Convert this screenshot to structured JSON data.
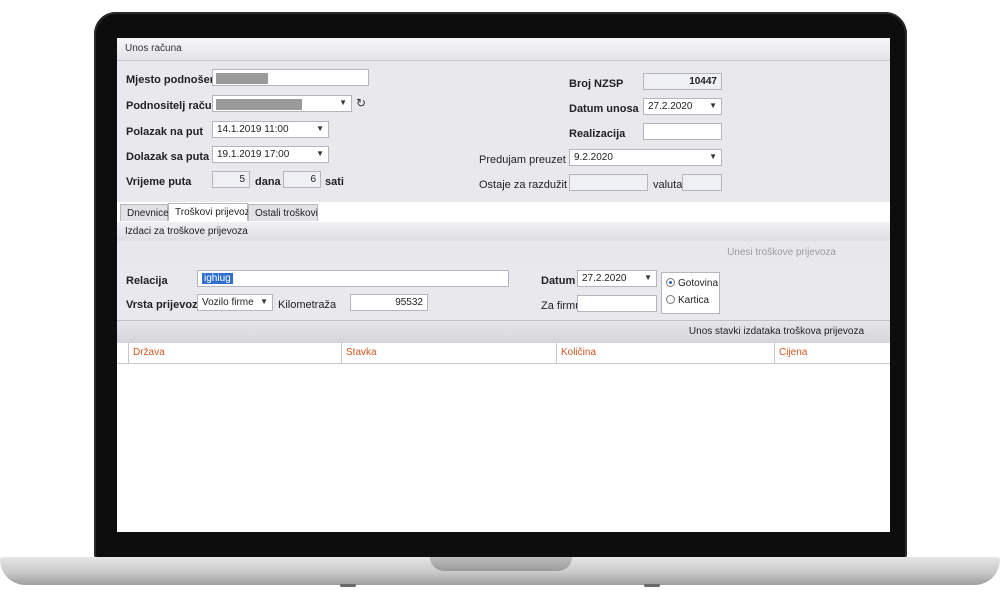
{
  "window": {
    "title": "Unos računa"
  },
  "header": {
    "mjesto_label": "Mjesto podnošenja",
    "podnositelj_label": "Podnositelj računa",
    "polazak_label": "Polazak na put",
    "polazak_value": "14.1.2019 11:00",
    "dolazak_label": "Dolazak sa puta",
    "dolazak_value": "19.1.2019 17:00",
    "vrijeme_label": "Vrijeme puta",
    "dana_value": "5",
    "dana_label": "dana",
    "sati_value": "6",
    "sati_label": "sati",
    "broj_label": "Broj NZSP",
    "broj_value": "10447",
    "datum_unosa_label": "Datum unosa",
    "datum_unosa_value": "27.2.2020",
    "realizacija_label": "Realizacija",
    "predujam_label": "Predujam preuzet",
    "predujam_value": "9.2.2020",
    "ostaje_label": "Ostaje za razdužit",
    "valuta_label": "valuta"
  },
  "tabs": [
    {
      "label": "Dnevnice"
    },
    {
      "label": "Troškovi prijevoza"
    },
    {
      "label": "Ostali troškovi"
    }
  ],
  "section": {
    "title": "Izdaci za troškove prijevoza",
    "action": "Unesi troškove prijevoza"
  },
  "detail": {
    "relacija_label": "Relacija",
    "relacija_value": "ighiug",
    "vrsta_label": "Vrsta prijevoza",
    "vrsta_value": "Vozilo firme",
    "km_label": "Kilometraža",
    "km_value": "95532",
    "datum_label": "Datum",
    "datum_value": "27.2.2020",
    "zafirmu_label": "Za firmu",
    "gotovina_label": "Gotovina",
    "kartica_label": "Kartica"
  },
  "grid": {
    "title": "Unos stavki izdataka troškova prijevoza",
    "columns": [
      "Država",
      "Stavka",
      "Količina",
      "Cijena"
    ]
  },
  "icons": {
    "dropdown": "chevron-down-icon",
    "refresh": "refresh-icon"
  },
  "colors": {
    "column_header_text": "#d0561e",
    "selection": "#2f6fd1"
  }
}
